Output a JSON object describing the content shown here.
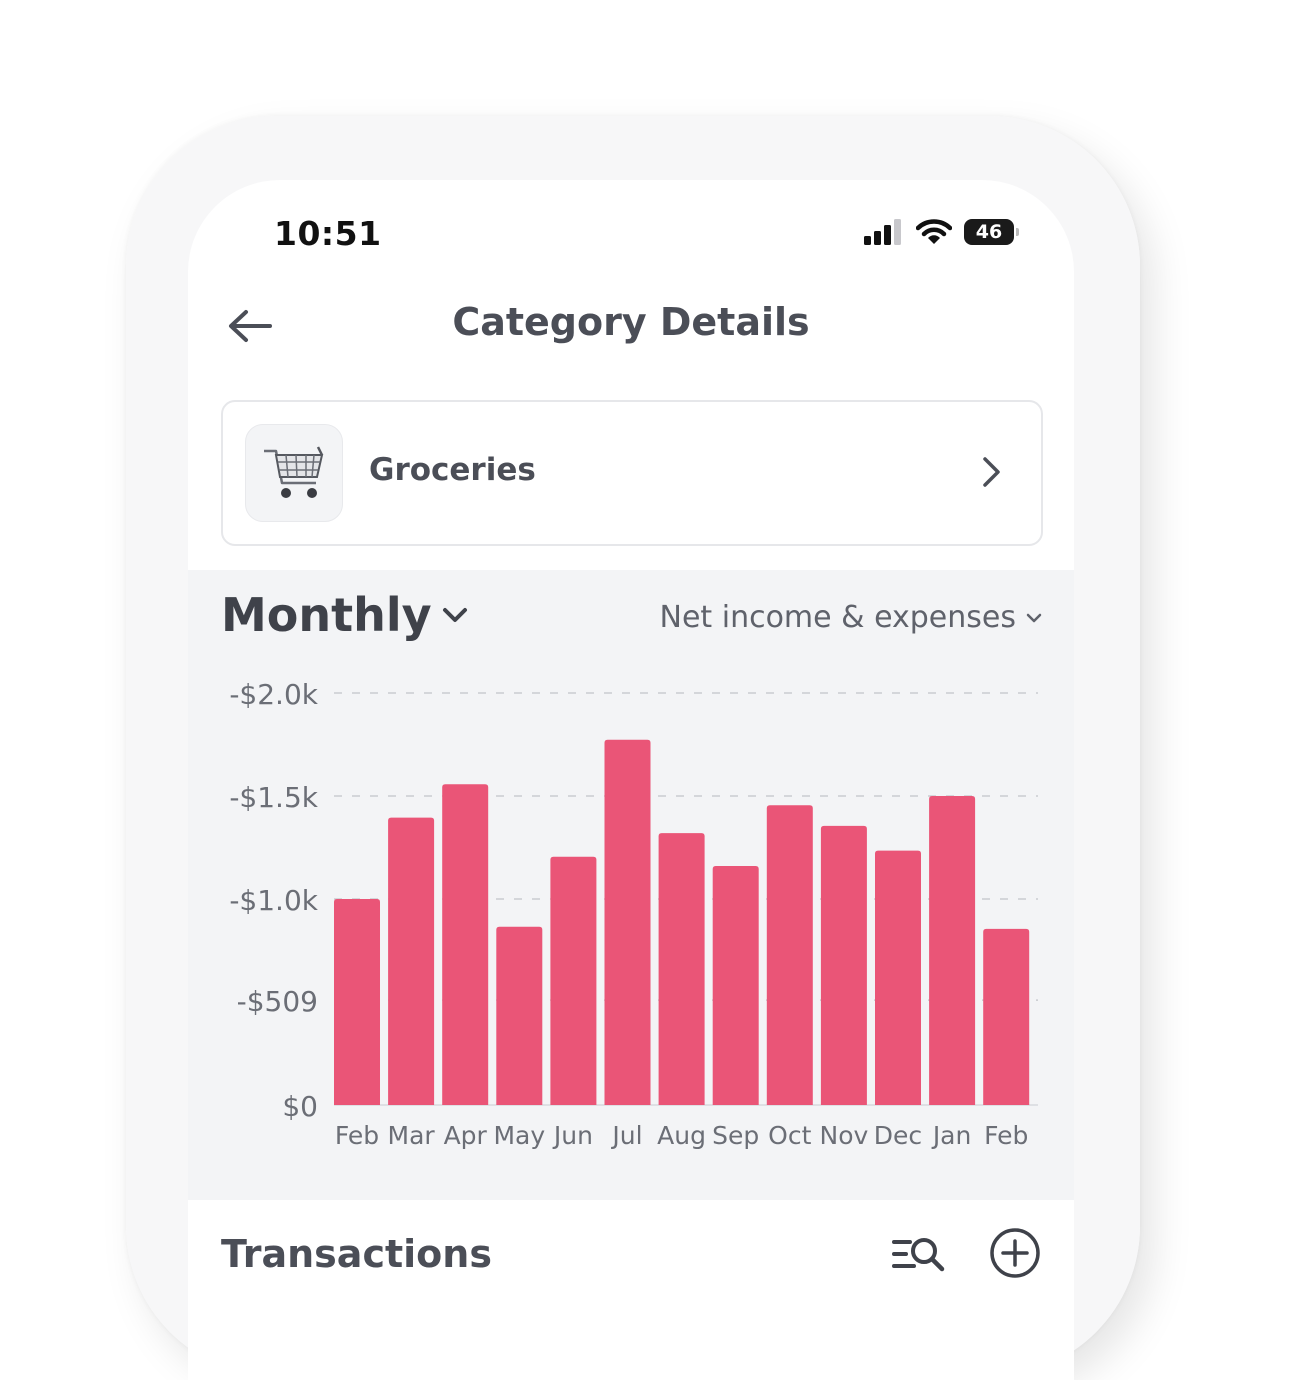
{
  "status": {
    "time": "10:51",
    "battery": "46"
  },
  "header": {
    "title": "Category Details"
  },
  "category": {
    "name": "Groceries",
    "icon": "shopping-cart-icon"
  },
  "chart_panel": {
    "period_label": "Monthly",
    "mode_label": "Net income & expenses"
  },
  "chart_data": {
    "type": "bar",
    "categories": [
      "Feb",
      "Mar",
      "Apr",
      "May",
      "Jun",
      "Jul",
      "Aug",
      "Sep",
      "Oct",
      "Nov",
      "Dec",
      "Jan",
      "Feb"
    ],
    "values": [
      1000,
      1395,
      1557,
      865,
      1205,
      1773,
      1320,
      1160,
      1455,
      1355,
      1235,
      1500,
      855
    ],
    "y_ticks": [
      {
        "value": 0,
        "label": "$0"
      },
      {
        "value": 509,
        "label": "-$509"
      },
      {
        "value": 1000,
        "label": "-$1.0k"
      },
      {
        "value": 1500,
        "label": "-$1.5k"
      },
      {
        "value": 2000,
        "label": "-$2.0k"
      }
    ],
    "ylim": [
      0,
      2000
    ],
    "grid": true,
    "bar_color": "#ea5577"
  },
  "transactions": {
    "title": "Transactions"
  }
}
